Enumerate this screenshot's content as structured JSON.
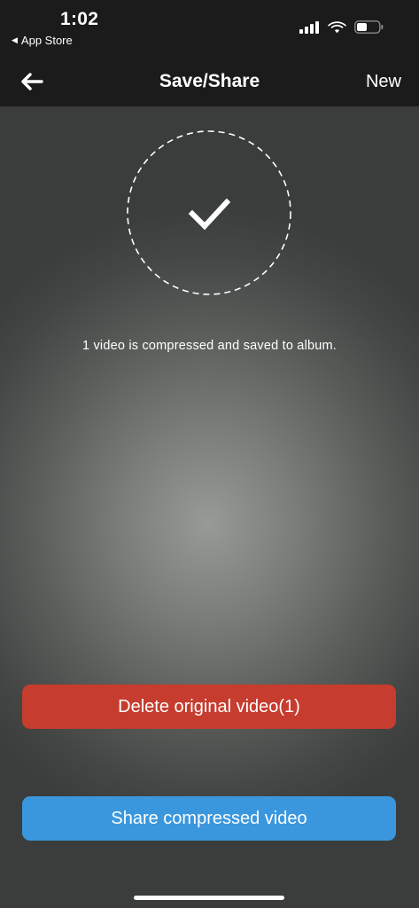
{
  "status_bar": {
    "time": "1:02",
    "back_app": "App Store",
    "back_glyph": "◀"
  },
  "nav": {
    "title": "Save/Share",
    "new_label": "New",
    "back_icon": "arrow-left-icon"
  },
  "result": {
    "icon": "checkmark-icon",
    "message": "1 video is compressed and saved to album."
  },
  "actions": {
    "delete_label": "Delete original video(1)",
    "share_label": "Share compressed video"
  },
  "colors": {
    "delete": "#c63c2e",
    "share": "#3a97de",
    "bar_background": "#1b1b1b"
  }
}
